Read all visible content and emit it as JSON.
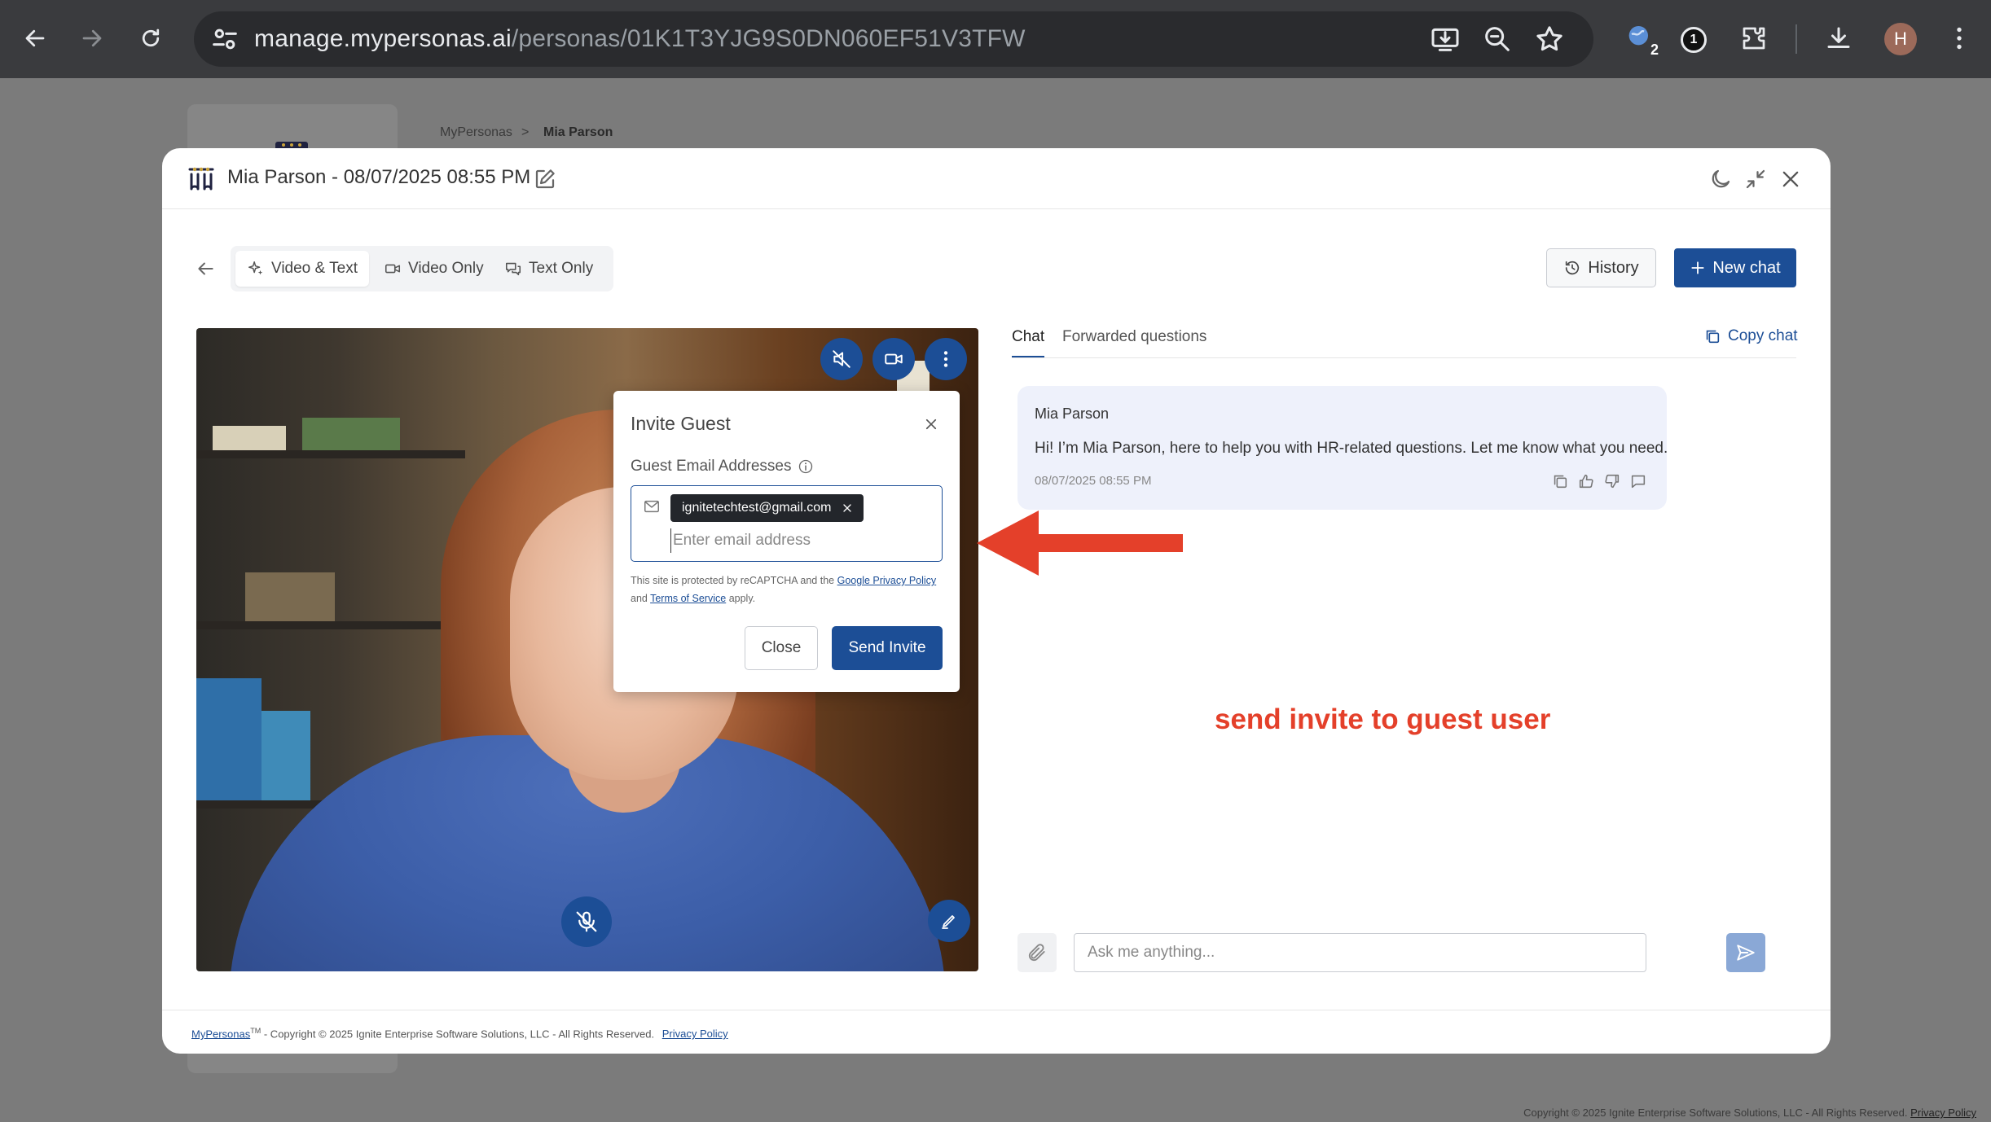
{
  "browser": {
    "url_host": "manage.mypersonas.ai",
    "url_path": "/personas/01K1T3YJG9S0DN060EF51V3TFW",
    "extension_badge": "2",
    "profile_badge": "1",
    "avatar_initial": "H"
  },
  "background": {
    "breadcrumb": {
      "root": "MyPersonas",
      "separator": ">",
      "current": "Mia Parson"
    },
    "footer_text": "Copyright © 2025 Ignite Enterprise Software Solutions, LLC - All Rights Reserved.",
    "footer_link": "Privacy Policy"
  },
  "modal": {
    "title": "Mia Parson - 08/07/2025 08:55 PM",
    "modes": [
      "Video & Text",
      "Video Only",
      "Text Only"
    ],
    "active_mode": "Video & Text",
    "history_label": "History",
    "new_chat_label": "New chat"
  },
  "invite": {
    "title": "Invite Guest",
    "label": "Guest Email Addresses",
    "chip_email": "ignitetechtest@gmail.com",
    "placeholder": "Enter email address",
    "recaptcha_prefix": "This site is protected by reCAPTCHA and the",
    "google_privacy_link": "Google Privacy Policy",
    "recaptcha_and": "and",
    "terms_link": "Terms of Service",
    "recaptcha_suffix": "apply.",
    "close_label": "Close",
    "send_label": "Send Invite"
  },
  "annotation": {
    "text": "send invite to guest user",
    "color": "#e4402a"
  },
  "chat": {
    "tabs": [
      "Chat",
      "Forwarded questions"
    ],
    "active_tab": "Chat",
    "copy_label": "Copy chat",
    "messages": [
      {
        "sender": "Mia Parson",
        "text": "Hi! I’m Mia Parson, here to help you with HR-related questions. Let me know what you need.",
        "time": "08/07/2025 08:55 PM"
      }
    ],
    "input_placeholder": "Ask me anything..."
  },
  "footer": {
    "brand": "MyPersonas",
    "tm": "TM",
    "text": " - Copyright © 2025 Ignite Enterprise Software Solutions, LLC - All Rights Reserved.",
    "privacy": "Privacy Policy"
  },
  "colors": {
    "primary": "#1c4e96",
    "send_disabled": "#8aa8d6",
    "message_bg": "#eef1fb"
  }
}
